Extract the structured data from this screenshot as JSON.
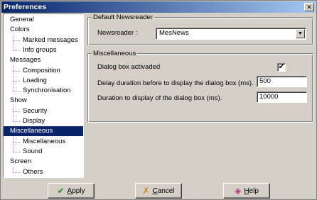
{
  "window": {
    "title": "Preferences",
    "close_glyph": "✕"
  },
  "tree": {
    "items": [
      {
        "label": "General",
        "level": 0
      },
      {
        "label": "Colors",
        "level": 0
      },
      {
        "label": "Marked messages",
        "level": 1
      },
      {
        "label": "Info groups",
        "level": 1
      },
      {
        "label": "Messages",
        "level": 0
      },
      {
        "label": "Composition",
        "level": 1
      },
      {
        "label": "Loading",
        "level": 1
      },
      {
        "label": "Synchronisation",
        "level": 1
      },
      {
        "label": "Show",
        "level": 0
      },
      {
        "label": "Security",
        "level": 1
      },
      {
        "label": "Display",
        "level": 1
      },
      {
        "label": "Miscellaneous",
        "level": 0,
        "selected": true
      },
      {
        "label": "Miscellaneous",
        "level": 1
      },
      {
        "label": "Sound",
        "level": 1
      },
      {
        "label": "Screen",
        "level": 0
      },
      {
        "label": "Others",
        "level": 1
      }
    ]
  },
  "newsreader_group": {
    "title": "Default Newsreader",
    "label": "Newsreader :",
    "value": "MesNews",
    "arrow": "▼"
  },
  "misc_group": {
    "title": "Miscellaneous",
    "dialog_label": "Dialog box activaded",
    "dialog_checked": "✔",
    "delay_label": "Delay duration before to display the dialog box (ms).",
    "delay_value": "500",
    "duration_label": "Duration to display of the dialog box (ms).",
    "duration_value": "10000"
  },
  "buttons": {
    "apply": {
      "prefix": "",
      "underline": "A",
      "rest": "pply",
      "icon": "check-icon",
      "glyph": "✔",
      "color": "#2a8a2a"
    },
    "cancel": {
      "prefix": "",
      "underline": "C",
      "rest": "ancel",
      "icon": "x-icon",
      "glyph": "✗",
      "color": "#d08000"
    },
    "help": {
      "prefix": "",
      "underline": "H",
      "rest": "elp",
      "icon": "eraser-icon",
      "glyph": "◈",
      "color": "#b03070"
    }
  }
}
